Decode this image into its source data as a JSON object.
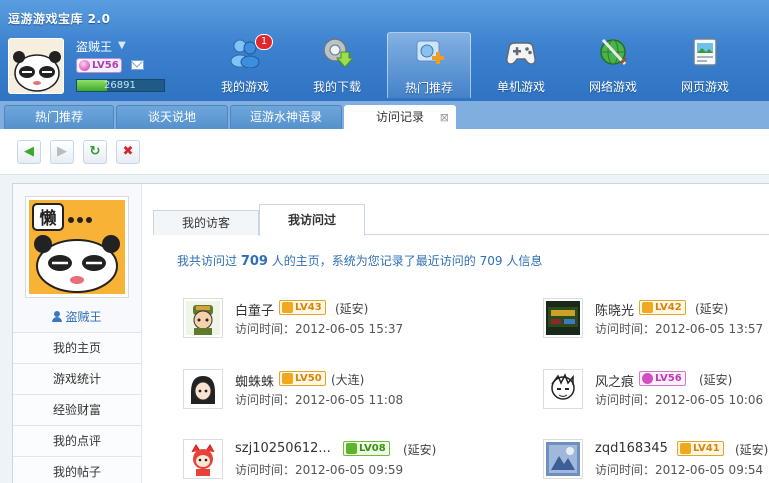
{
  "app": {
    "title": "逗游游戏宝库 2.0"
  },
  "user": {
    "name": "盗贼王",
    "level": "LV56",
    "exp": "26891"
  },
  "nav": [
    {
      "label": "我的游戏",
      "badge": "1"
    },
    {
      "label": "我的下载"
    },
    {
      "label": "热门推荐"
    },
    {
      "label": "单机游戏"
    },
    {
      "label": "网络游戏"
    },
    {
      "label": "网页游戏"
    }
  ],
  "tabs": [
    {
      "label": "热门推荐"
    },
    {
      "label": "谈天说地"
    },
    {
      "label": "逗游水神语录"
    },
    {
      "label": "访问记录",
      "close": "⊠"
    }
  ],
  "toolbar": {
    "back": "◀",
    "forward": "▶",
    "refresh": "↻",
    "stop": "✖"
  },
  "profile": {
    "name": "盗贼王",
    "menu": [
      "我的主页",
      "游戏统计",
      "经验财富",
      "我的点评",
      "我的帖子"
    ]
  },
  "subtabs": [
    "我的访客",
    "我访问过"
  ],
  "summary": {
    "prefix": "我共访问过 ",
    "count1": "709",
    "middle": " 人的主页，系统为您记录了最近访问的 ",
    "count2": "709",
    "suffix": " 人信息"
  },
  "visitors": [
    {
      "name": "白童子",
      "level": "LV43",
      "location": "(延安)",
      "time": "访问时间：2012-06-05 15:37"
    },
    {
      "name": "陈晓光",
      "level": "LV42",
      "location": "(延安)",
      "time": "访问时间：2012-06-05 13:57"
    },
    {
      "name": "蜘蛛蛛",
      "level": "LV50",
      "location": "(大连)",
      "time": "访问时间：2012-06-05 11:08"
    },
    {
      "name": "风之痕",
      "level": "LV56",
      "location": "(延安)",
      "time": "访问时间：2012-06-05 10:06"
    },
    {
      "name": "szj10250612...",
      "level": "LV08",
      "location": "(延安)",
      "time": "访问时间：2012-06-05 09:59"
    },
    {
      "name": "zqd168345",
      "level": "LV41",
      "location": "(延安)",
      "time": "访问时间：2012-06-05 09:54"
    }
  ]
}
